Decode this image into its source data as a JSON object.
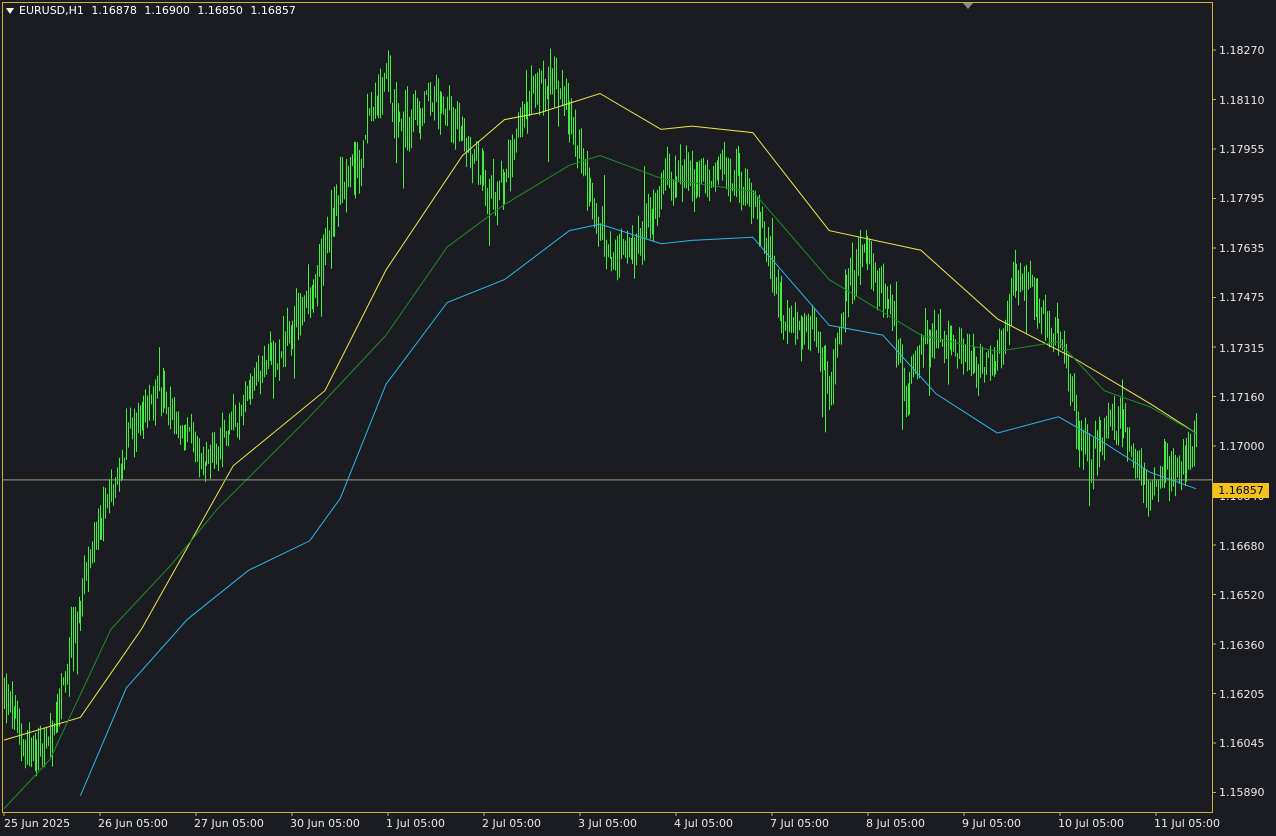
{
  "header": {
    "symbol": "EURUSD,H1",
    "open": "1.16878",
    "high": "1.16900",
    "low": "1.16850",
    "close": "1.16857"
  },
  "price_axis": [
    "1.18270",
    "1.18110",
    "1.17955",
    "1.17795",
    "1.17635",
    "1.17475",
    "1.17315",
    "1.17160",
    "1.17000",
    "1.16840",
    "1.16680",
    "1.16520",
    "1.16360",
    "1.16205",
    "1.16045",
    "1.15890"
  ],
  "current_price": "1.16857",
  "time_axis": [
    "25 Jun 2025",
    "26 Jun 05:00",
    "27 Jun 05:00",
    "30 Jun 05:00",
    "1 Jul 05:00",
    "2 Jul 05:00",
    "3 Jul 05:00",
    "4 Jul 05:00",
    "7 Jul 05:00",
    "8 Jul 05:00",
    "9 Jul 05:00",
    "10 Jul 05:00",
    "11 Jul 05:00"
  ],
  "colors": {
    "background": "#1b1c21",
    "candle": "#3cf03c",
    "ma_yellow": "#f0e64a",
    "ma_green": "#1e8c2a",
    "ma_blue": "#2ab7f0",
    "current_line": "#9a9a7a",
    "current_box": "#f2c21b",
    "axis": "#c8b432"
  },
  "chart_data": {
    "type": "candlestick",
    "symbol": "EURUSD",
    "timeframe": "H1",
    "ylim": [
      1.1584,
      1.1832
    ],
    "close_path": [
      [
        0,
        1.162
      ],
      [
        8,
        1.1608
      ],
      [
        16,
        1.16
      ],
      [
        24,
        1.1607
      ],
      [
        32,
        1.1625
      ],
      [
        40,
        1.165
      ],
      [
        48,
        1.167
      ],
      [
        56,
        1.168
      ],
      [
        64,
        1.1697
      ],
      [
        72,
        1.1707
      ],
      [
        80,
        1.1715
      ],
      [
        88,
        1.1705
      ],
      [
        96,
        1.1698
      ],
      [
        104,
        1.169
      ],
      [
        112,
        1.1696
      ],
      [
        120,
        1.1705
      ],
      [
        128,
        1.1712
      ],
      [
        136,
        1.1722
      ],
      [
        144,
        1.1725
      ],
      [
        152,
        1.1735
      ],
      [
        160,
        1.1738
      ],
      [
        168,
        1.176
      ],
      [
        176,
        1.1775
      ],
      [
        184,
        1.178
      ],
      [
        192,
        1.1798
      ],
      [
        200,
        1.1808
      ],
      [
        208,
        1.1795
      ],
      [
        216,
        1.1798
      ],
      [
        224,
        1.1803
      ],
      [
        232,
        1.1798
      ],
      [
        240,
        1.179
      ],
      [
        248,
        1.1782
      ],
      [
        256,
        1.177
      ],
      [
        264,
        1.178
      ],
      [
        272,
        1.18
      ],
      [
        280,
        1.1806
      ],
      [
        288,
        1.1808
      ],
      [
        296,
        1.1798
      ],
      [
        304,
        1.178
      ],
      [
        312,
        1.1762
      ],
      [
        320,
        1.1755
      ],
      [
        328,
        1.1755
      ],
      [
        336,
        1.1763
      ],
      [
        344,
        1.1776
      ],
      [
        352,
        1.1781
      ],
      [
        360,
        1.1777
      ],
      [
        368,
        1.178
      ],
      [
        376,
        1.178
      ],
      [
        384,
        1.1778
      ],
      [
        392,
        1.177
      ],
      [
        400,
        1.1755
      ],
      [
        408,
        1.1734
      ],
      [
        416,
        1.173
      ],
      [
        424,
        1.1733
      ],
      [
        432,
        1.171
      ],
      [
        440,
        1.1744
      ],
      [
        448,
        1.1755
      ],
      [
        456,
        1.1748
      ],
      [
        464,
        1.1738
      ],
      [
        472,
        1.1712
      ],
      [
        480,
        1.1728
      ],
      [
        488,
        1.173
      ],
      [
        496,
        1.1728
      ],
      [
        504,
        1.1726
      ],
      [
        512,
        1.1718
      ],
      [
        520,
        1.1725
      ],
      [
        528,
        1.1744
      ],
      [
        536,
        1.1744
      ],
      [
        544,
        1.1736
      ],
      [
        552,
        1.173
      ],
      [
        560,
        1.1706
      ],
      [
        568,
        1.169
      ],
      [
        576,
        1.17
      ],
      [
        584,
        1.1706
      ],
      [
        592,
        1.1692
      ],
      [
        600,
        1.168
      ],
      [
        608,
        1.1688
      ],
      [
        616,
        1.169
      ],
      [
        624,
        1.1698
      ]
    ],
    "series": [
      {
        "color": "yellow",
        "values": [
          [
            0,
            1.1606
          ],
          [
            40,
            1.1613
          ],
          [
            72,
            1.164
          ],
          [
            120,
            1.169
          ],
          [
            168,
            1.1713
          ],
          [
            200,
            1.175
          ],
          [
            240,
            1.1785
          ],
          [
            262,
            1.1796
          ],
          [
            280,
            1.1798
          ],
          [
            312,
            1.1804
          ],
          [
            344,
            1.1793
          ],
          [
            360,
            1.1794
          ],
          [
            392,
            1.1792
          ],
          [
            432,
            1.1762
          ],
          [
            480,
            1.1756
          ],
          [
            520,
            1.1735
          ],
          [
            560,
            1.1723
          ],
          [
            600,
            1.1709
          ],
          [
            624,
            1.17
          ]
        ]
      },
      {
        "color": "green",
        "values": [
          [
            0,
            1.1585
          ],
          [
            24,
            1.16
          ],
          [
            56,
            1.164
          ],
          [
            88,
            1.166
          ],
          [
            112,
            1.1677
          ],
          [
            160,
            1.1705
          ],
          [
            200,
            1.173
          ],
          [
            232,
            1.1757
          ],
          [
            262,
            1.177
          ],
          [
            296,
            1.1782
          ],
          [
            312,
            1.1785
          ],
          [
            344,
            1.1778
          ],
          [
            392,
            1.1774
          ],
          [
            432,
            1.1747
          ],
          [
            480,
            1.173
          ],
          [
            520,
            1.1725
          ],
          [
            552,
            1.1728
          ],
          [
            576,
            1.1713
          ],
          [
            600,
            1.1708
          ],
          [
            624,
            1.17
          ]
        ]
      },
      {
        "color": "blue",
        "values": [
          [
            40,
            1.1589
          ],
          [
            64,
            1.1622
          ],
          [
            96,
            1.1643
          ],
          [
            128,
            1.1658
          ],
          [
            160,
            1.1667
          ],
          [
            176,
            1.168
          ],
          [
            200,
            1.1715
          ],
          [
            232,
            1.174
          ],
          [
            262,
            1.1747
          ],
          [
            296,
            1.1762
          ],
          [
            312,
            1.1764
          ],
          [
            344,
            1.1758
          ],
          [
            360,
            1.1759
          ],
          [
            392,
            1.176
          ],
          [
            432,
            1.1733
          ],
          [
            460,
            1.173
          ],
          [
            488,
            1.1712
          ],
          [
            520,
            1.17
          ],
          [
            552,
            1.1705
          ],
          [
            576,
            1.1697
          ],
          [
            600,
            1.1688
          ],
          [
            624,
            1.1683
          ]
        ]
      }
    ]
  }
}
